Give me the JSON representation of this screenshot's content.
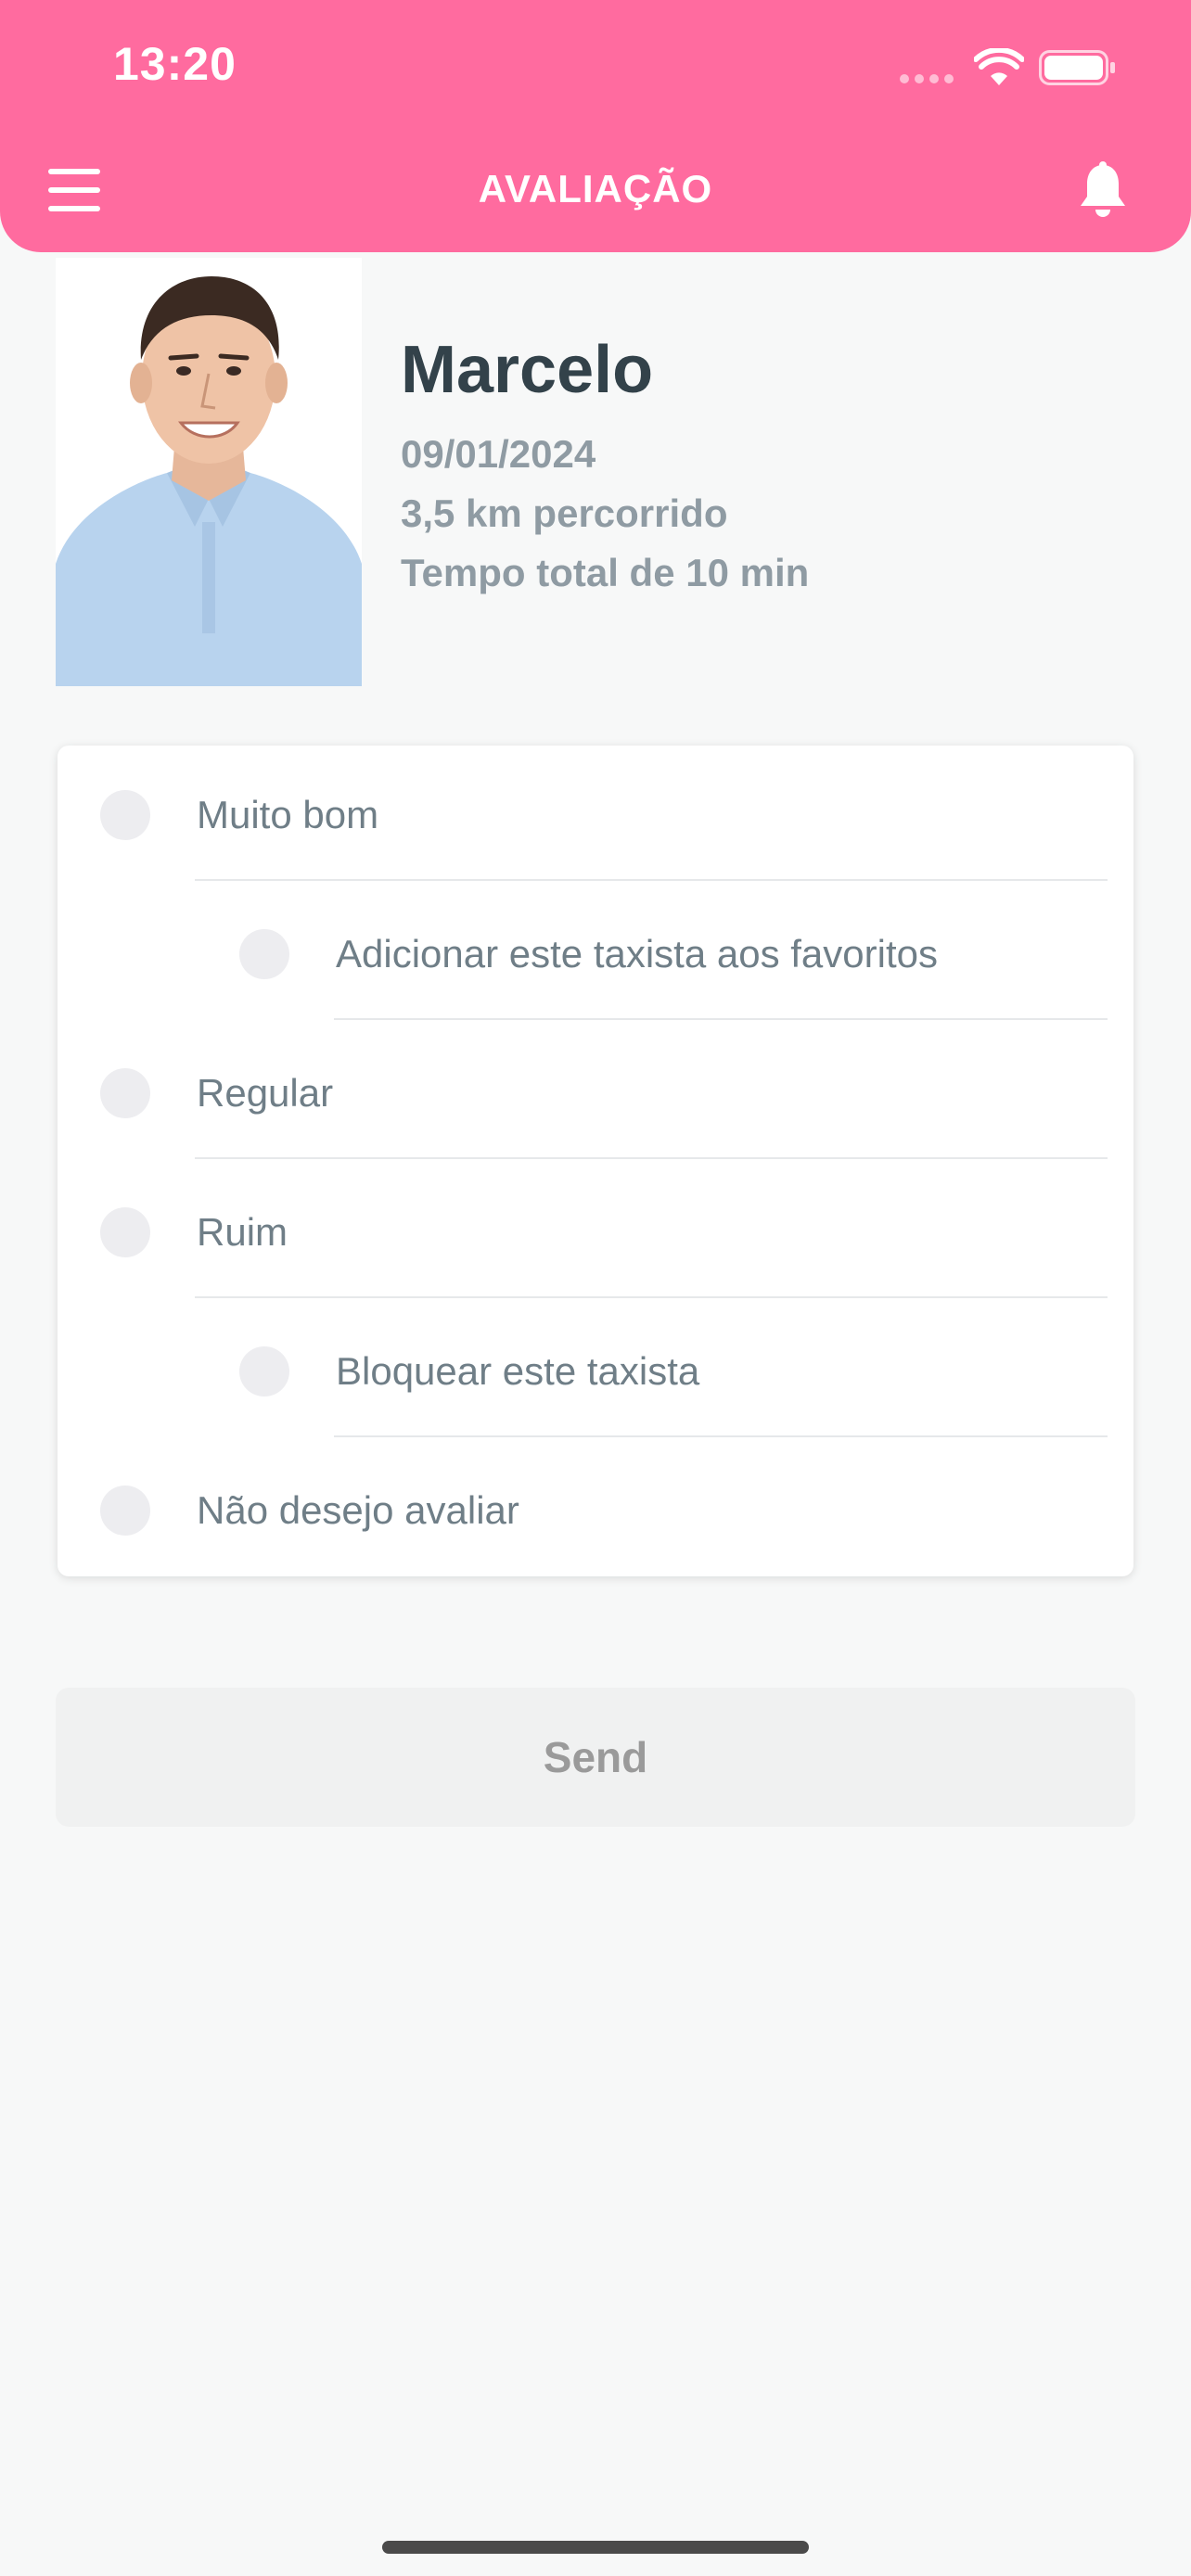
{
  "status_bar": {
    "time": "13:20"
  },
  "header": {
    "title": "AVALIAÇÃO",
    "background": "#ff6b9f"
  },
  "icons": {
    "menu": "menu-icon",
    "bell": "bell-icon",
    "wifi": "wifi-icon",
    "battery": "battery-icon"
  },
  "driver": {
    "name": "Marcelo",
    "date": "09/01/2024",
    "distance": "3,5 km percorrido",
    "total_time": "Tempo total de 10 min"
  },
  "rating_options": [
    {
      "label": "Muito bom",
      "selected": false
    },
    {
      "label": "Adicionar este taxista aos favoritos",
      "selected": false
    },
    {
      "label": "Regular",
      "selected": false
    },
    {
      "label": "Ruim",
      "selected": false
    },
    {
      "label": "Bloquear este taxista",
      "selected": false
    },
    {
      "label": "Não desejo avaliar",
      "selected": false
    }
  ],
  "send_button": {
    "label": "Send",
    "enabled": false
  }
}
